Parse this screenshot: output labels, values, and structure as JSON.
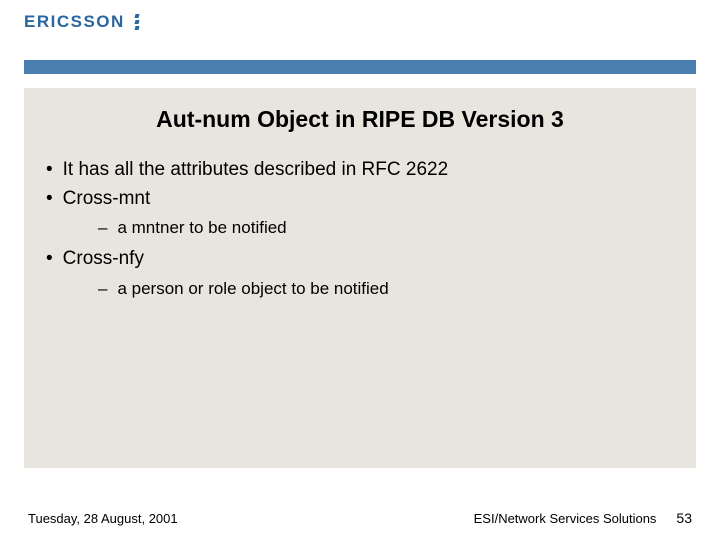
{
  "brand": {
    "name": "ERICSSON",
    "accent_color": "#2a66a0"
  },
  "slide": {
    "title": "Aut-num Object in RIPE DB Version 3",
    "bullets": [
      {
        "text": "It has all the attributes described in RFC 2622"
      },
      {
        "text": "Cross-mnt",
        "sub": [
          "a mntner to be notified"
        ]
      },
      {
        "text": "Cross-nfy",
        "sub": [
          "a person or role object to be notified"
        ]
      }
    ]
  },
  "footer": {
    "date": "Tuesday, 28 August, 2001",
    "org": "ESI/Network Services Solutions",
    "page": "53"
  },
  "colors": {
    "header_bar": "#4a7eb0",
    "content_bg": "#e8e5de"
  }
}
